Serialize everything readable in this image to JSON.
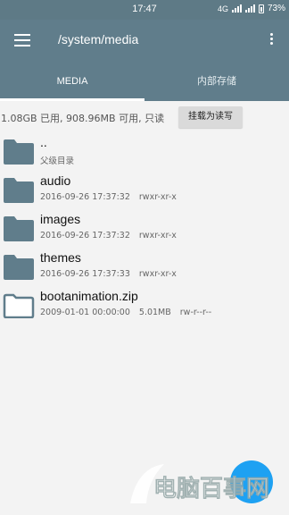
{
  "status_bar": {
    "time": "17:47",
    "network": "4G",
    "battery": "73%"
  },
  "app_bar": {
    "path": "/system/media"
  },
  "tabs": [
    {
      "label": "MEDIA",
      "active": true
    },
    {
      "label": "内部存储",
      "active": false
    }
  ],
  "storage_info": {
    "text": "1.08GB 已用, 908.96MB 可用, 只读",
    "remount_label": "挂载为读写"
  },
  "files": [
    {
      "name": "..",
      "date": "父级目录",
      "size": "",
      "perms": "",
      "type": "folder"
    },
    {
      "name": "audio",
      "date": "2016-09-26 17:37:32",
      "size": "",
      "perms": "rwxr-xr-x",
      "type": "folder"
    },
    {
      "name": "images",
      "date": "2016-09-26 17:37:32",
      "size": "",
      "perms": "rwxr-xr-x",
      "type": "folder"
    },
    {
      "name": "themes",
      "date": "2016-09-26 17:37:33",
      "size": "",
      "perms": "rwxr-xr-x",
      "type": "folder"
    },
    {
      "name": "bootanimation.zip",
      "date": "2009-01-01 00:00:00",
      "size": "5.01MB",
      "perms": "rw-r--r--",
      "type": "file"
    }
  ],
  "watermark": {
    "text": "电脑百事网"
  },
  "colors": {
    "accent": "#607d8b",
    "folder": "#607d8b",
    "fab": "#1ea1f2"
  }
}
